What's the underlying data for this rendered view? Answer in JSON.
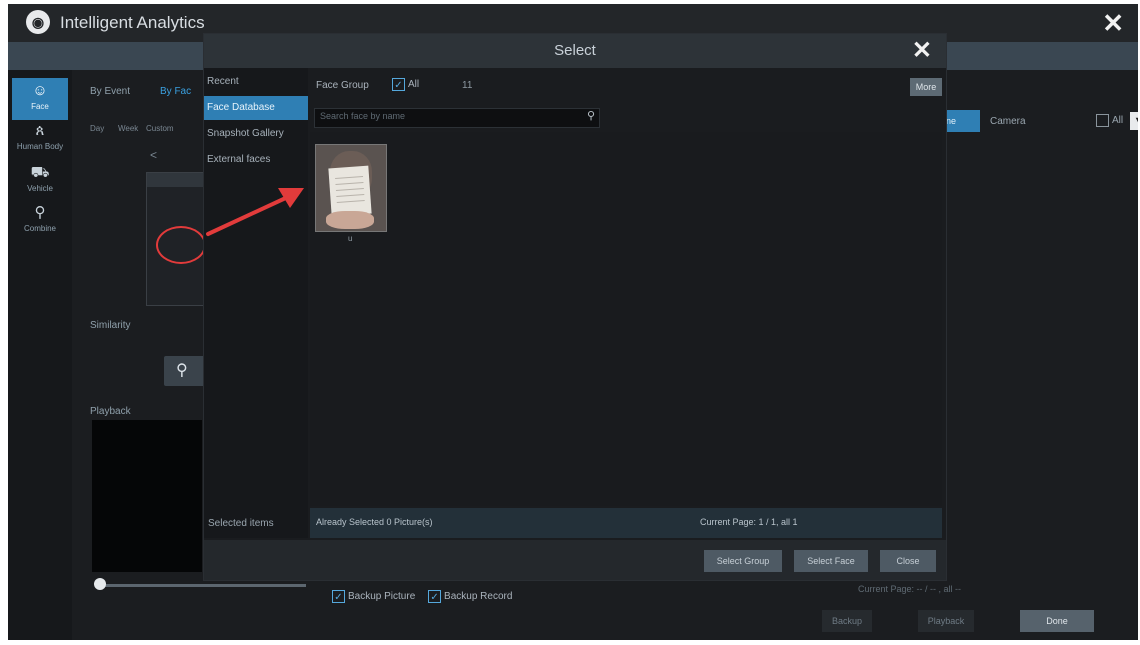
{
  "app": {
    "title": "Intelligent Analytics",
    "close_glyph": "✕"
  },
  "left_nav": [
    {
      "label": "Face",
      "icon": "face-icon",
      "glyph": "☺",
      "active": true
    },
    {
      "label": "Human Body",
      "icon": "human-body-icon",
      "glyph": "ጰ",
      "active": false
    },
    {
      "label": "Vehicle",
      "icon": "vehicle-icon",
      "glyph": "⛟",
      "active": false
    },
    {
      "label": "Combine",
      "icon": "combine-icon",
      "glyph": "⚲",
      "active": false
    }
  ],
  "background": {
    "tabs": [
      "By Event",
      "By Fac"
    ],
    "period": [
      "Day",
      "Week",
      "Custom"
    ],
    "similarity_label": "Similarity",
    "playback_label": "Playback",
    "backup_picture": "Backup Picture",
    "backup_record": "Backup Record",
    "camera_label": "Camera",
    "all_label": "All",
    "current_page": "Current Page: -- / -- , all --",
    "buttons": {
      "backup": "Backup",
      "playback": "Playback",
      "done": "Done"
    },
    "filter_icon": "filter-icon",
    "search_icon": "search-icon",
    "blue_tab": "ne",
    "nav_prev": "<"
  },
  "dialog": {
    "title": "Select",
    "close_glyph": "✕",
    "categories": [
      "Recent",
      "Face Database",
      "Snapshot Gallery",
      "External faces"
    ],
    "active_category": 1,
    "selected_items_label": "Selected items",
    "face_group_label": "Face Group",
    "all_label": "All",
    "count": "11",
    "more_button": "More",
    "search_placeholder": "Search face by name",
    "thumbnail_label": "u",
    "status_left": "Already Selected 0 Picture(s)",
    "status_right": "Current Page: 1 / 1, all 1",
    "footer_buttons": {
      "select_group": "Select Group",
      "select_face": "Select Face",
      "close": "Close"
    }
  },
  "annotation_color": "#e23b3b",
  "accent_color": "#2f7fb4"
}
